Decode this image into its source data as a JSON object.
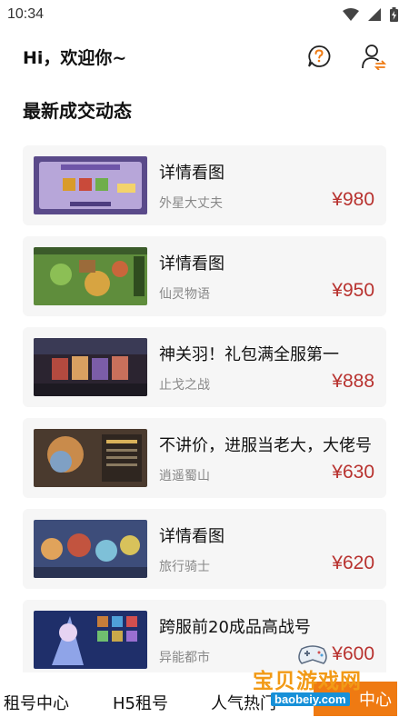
{
  "status_bar": {
    "time": "10:34"
  },
  "header": {
    "greeting": "Hi，欢迎你~",
    "help_icon": "question-bubble-icon",
    "user_icon": "user-swap-icon"
  },
  "section": {
    "title": "最新成交动态"
  },
  "listings": [
    {
      "title": "详情看图",
      "game": "外星大丈夫",
      "price": "¥980"
    },
    {
      "title": "详情看图",
      "game": "仙灵物语",
      "price": "¥950"
    },
    {
      "title": "神关羽！礼包满全服第一",
      "game": "止戈之战",
      "price": "¥888"
    },
    {
      "title": "不讲价，进服当老大，大佬号",
      "game": "逍遥蜀山",
      "price": "¥630"
    },
    {
      "title": "详情看图",
      "game": "旅行骑士",
      "price": "¥620"
    },
    {
      "title": "跨服前20成品高战号",
      "game": "异能都市",
      "price": "¥600"
    }
  ],
  "tabbar": {
    "tabs": [
      "租号中心",
      "H5租号",
      "人气热门",
      "中心"
    ]
  },
  "watermark": {
    "text": "宝贝游戏网",
    "url": "baobeiy.com"
  },
  "colors": {
    "price": "#b8322f",
    "accent": "#ef7a12",
    "card_bg": "#f6f6f6"
  }
}
